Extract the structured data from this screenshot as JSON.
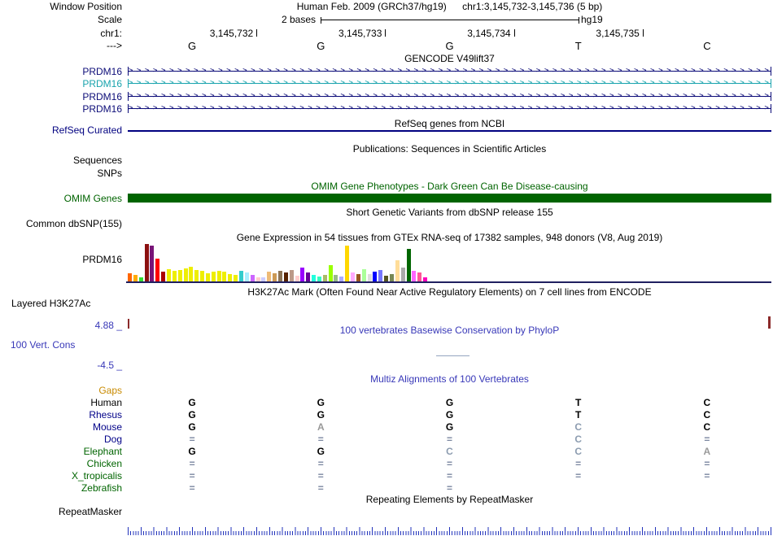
{
  "header": {
    "window_position_label": "Window Position",
    "assembly_title": "Human Feb. 2009 (GRCh37/hg19)",
    "position_text": "chr1:3,145,732-3,145,736 (5 bp)",
    "scale_label": "Scale",
    "scale_text": "2 bases",
    "genome_label": "hg19",
    "chrom_label": "chr1:",
    "coordinates": [
      "3,145,732",
      "3,145,733",
      "3,145,734",
      "3,145,735"
    ],
    "direction_arrow": "--->",
    "bases": [
      "G",
      "G",
      "G",
      "T",
      "C"
    ]
  },
  "gencode": {
    "title": "GENCODE V49lift37",
    "transcripts": [
      {
        "label": "PRDM16",
        "color": "#0C0C78"
      },
      {
        "label": "PRDM16",
        "color": "#18A3AD"
      },
      {
        "label": "PRDM16",
        "color": "#0C0C78"
      },
      {
        "label": "PRDM16",
        "color": "#0C0C78"
      }
    ]
  },
  "refseq": {
    "center_title": "RefSeq genes from NCBI",
    "label": "RefSeq Curated",
    "line_color": "#000080"
  },
  "publications": {
    "center_title": "Publications: Sequences in Scientific Articles",
    "label": "Sequences"
  },
  "snps": {
    "label": "SNPs"
  },
  "omim": {
    "center_title": "OMIM Gene Phenotypes - Dark Green Can Be Disease-causing",
    "label": "OMIM Genes",
    "bar_color": "#006400"
  },
  "dbsnp": {
    "center_title": "Short Genetic Variants from dbSNP release 155",
    "label": "Common dbSNP(155)"
  },
  "gtex": {
    "center_title": "Gene Expression in 54 tissues from GTEx RNA-seq of 17382 samples, 948 donors (V8, Aug 2019)",
    "label": "PRDM16"
  },
  "h3k27ac": {
    "center_title": "H3K27Ac Mark (Often Found Near Active Regulatory Elements) on 7 cell lines from ENCODE",
    "label": "Layered H3K27Ac"
  },
  "conservation": {
    "center_title": "100 vertebrates Basewise Conservation by PhyloP",
    "label": "100 Vert. Cons",
    "max_label": "4.88 _",
    "min_label": "-4.5 _"
  },
  "multiz": {
    "center_title": "Multiz Alignments of 100 Vertebrates",
    "gaps_label": "Gaps",
    "rows": [
      {
        "label": "Human",
        "label_color": "#000000",
        "cells": [
          "G",
          "G",
          "G",
          "T",
          "C"
        ],
        "cell_colors": [
          "#000000",
          "#000000",
          "#000000",
          "#000000",
          "#000000"
        ]
      },
      {
        "label": "Rhesus",
        "label_color": "#000088",
        "cells": [
          "G",
          "G",
          "G",
          "T",
          "C"
        ],
        "cell_colors": [
          "#000000",
          "#000000",
          "#000000",
          "#000000",
          "#000000"
        ]
      },
      {
        "label": "Mouse",
        "label_color": "#000088",
        "cells": [
          "G",
          "A",
          "G",
          "C",
          "C"
        ],
        "cell_colors": [
          "#000000",
          "#999999",
          "#000000",
          "#8C9CB0",
          "#000000"
        ]
      },
      {
        "label": "Dog",
        "label_color": "#000088",
        "cells": [
          "=",
          "=",
          "=",
          "C",
          "="
        ],
        "cell_colors": [
          "#7A86A0",
          "#7A86A0",
          "#7A86A0",
          "#8C9CB0",
          "#7A86A0"
        ]
      },
      {
        "label": "Elephant",
        "label_color": "#006400",
        "cells": [
          "G",
          "G",
          "C",
          "C",
          "A"
        ],
        "cell_colors": [
          "#000000",
          "#000000",
          "#8C9CB0",
          "#8C9CB0",
          "#999999"
        ]
      },
      {
        "label": "Chicken",
        "label_color": "#006400",
        "cells": [
          "=",
          "=",
          "=",
          "=",
          "="
        ],
        "cell_colors": [
          "#7A86A0",
          "#7A86A0",
          "#7A86A0",
          "#7A86A0",
          "#7A86A0"
        ]
      },
      {
        "label": "X_tropicalis",
        "label_color": "#006400",
        "cells": [
          "=",
          "=",
          "=",
          "=",
          "="
        ],
        "cell_colors": [
          "#7A86A0",
          "#7A86A0",
          "#7A86A0",
          "#7A86A0",
          "#7A86A0"
        ]
      },
      {
        "label": "Zebrafish",
        "label_color": "#006400",
        "cells": [
          "=",
          "=",
          "=",
          "",
          ""
        ],
        "cell_colors": [
          "#7A86A0",
          "#7A86A0",
          "#7A86A0",
          "",
          ""
        ]
      }
    ]
  },
  "repeatmasker": {
    "center_title": "Repeating Elements by RepeatMasker",
    "label": "RepeatMasker"
  },
  "chart_data": {
    "type": "bar",
    "title": "Gene Expression in 54 tissues from GTEx RNA-seq of 17382 samples, 948 donors (V8, Aug 2019)",
    "gene": "PRDM16",
    "n_bars": 54,
    "ylim": [
      0,
      50
    ],
    "values": [
      10,
      8,
      5,
      46,
      44,
      28,
      12,
      15,
      13,
      14,
      16,
      18,
      14,
      13,
      10,
      12,
      13,
      12,
      9,
      8,
      13,
      11,
      8,
      5,
      5,
      12,
      10,
      13,
      11,
      14,
      7,
      17,
      11,
      8,
      6,
      8,
      20,
      8,
      6,
      44,
      11,
      9,
      15,
      9,
      12,
      14,
      7,
      9,
      26,
      17,
      40,
      13,
      11,
      5
    ],
    "colors": [
      "#FF6600",
      "#FFAA00",
      "#33DD33",
      "#8B1010",
      "#781478",
      "#FF0000",
      "#AA0000",
      "#EEEE00",
      "#EEEE00",
      "#EEEE00",
      "#EEEE00",
      "#EEEE00",
      "#EEEE00",
      "#EEEE00",
      "#EEEE00",
      "#EEEE00",
      "#EEEE00",
      "#EEEE00",
      "#EEEE00",
      "#EEEE00",
      "#33CCCC",
      "#AAEEFF",
      "#CC66FF",
      "#FFCCCC",
      "#CCCCFF",
      "#EEBB77",
      "#CC9955",
      "#8B7355",
      "#552200",
      "#BB9988",
      "#FFCCCC",
      "#9900FF",
      "#660099",
      "#22FFDD",
      "#33FFC2",
      "#AABB66",
      "#99FF00",
      "#99BB88",
      "#AAAAFF",
      "#FFD700",
      "#FFAAFF",
      "#995522",
      "#AAFF99",
      "#DDDDDD",
      "#0000FF",
      "#7777FF",
      "#555522",
      "#778855",
      "#FFDD99",
      "#AAAAAA",
      "#006600",
      "#FF66FF",
      "#FF5599",
      "#FF00BB"
    ]
  }
}
